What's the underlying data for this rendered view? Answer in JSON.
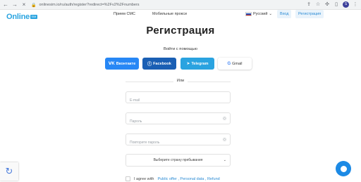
{
  "browser": {
    "url": "onlinesim.io/ru/auth/register?redirect=%2Fv2%2Fnumbers",
    "icons": [
      "back-icon",
      "forward-icon",
      "reload-icon",
      "lock-icon",
      "share-icon",
      "star-icon",
      "puzzle-icon",
      "sidebar-icon",
      "profile-icon",
      "menu-icon"
    ],
    "profile_initial": "S"
  },
  "header": {
    "logo_text": "Online",
    "logo_badge": "SIM",
    "nav": [
      "Прием СМС",
      "Мобильные прокси"
    ],
    "language": "Русский",
    "login_label": "Вход",
    "register_label": "Регистрация"
  },
  "page": {
    "title": "Регистрация",
    "subtitle": "Войти с помощью",
    "social": [
      {
        "label": "Вконтакте",
        "icon": "vk-icon",
        "color": "#2787f5"
      },
      {
        "label": "Facebook",
        "icon": "facebook-icon",
        "color": "#1a5fb4"
      },
      {
        "label": "Telegram",
        "icon": "telegram-icon",
        "color": "#2aa3e0"
      },
      {
        "label": "Gmail",
        "icon": "google-icon",
        "color": "#ffffff"
      }
    ],
    "or_text": "Или",
    "email_placeholder": "E-mail",
    "password_placeholder": "Пароль",
    "repeat_password_placeholder": "Повторите пароль",
    "country_select": "Выберите страну пребывания",
    "agree_prefix": "I agree with",
    "agree_links": "Public offer , Personal data , Refund"
  },
  "colors": {
    "accent": "#2aa4e0",
    "link": "#2a8ad4",
    "chat": "#1c8ae5"
  }
}
